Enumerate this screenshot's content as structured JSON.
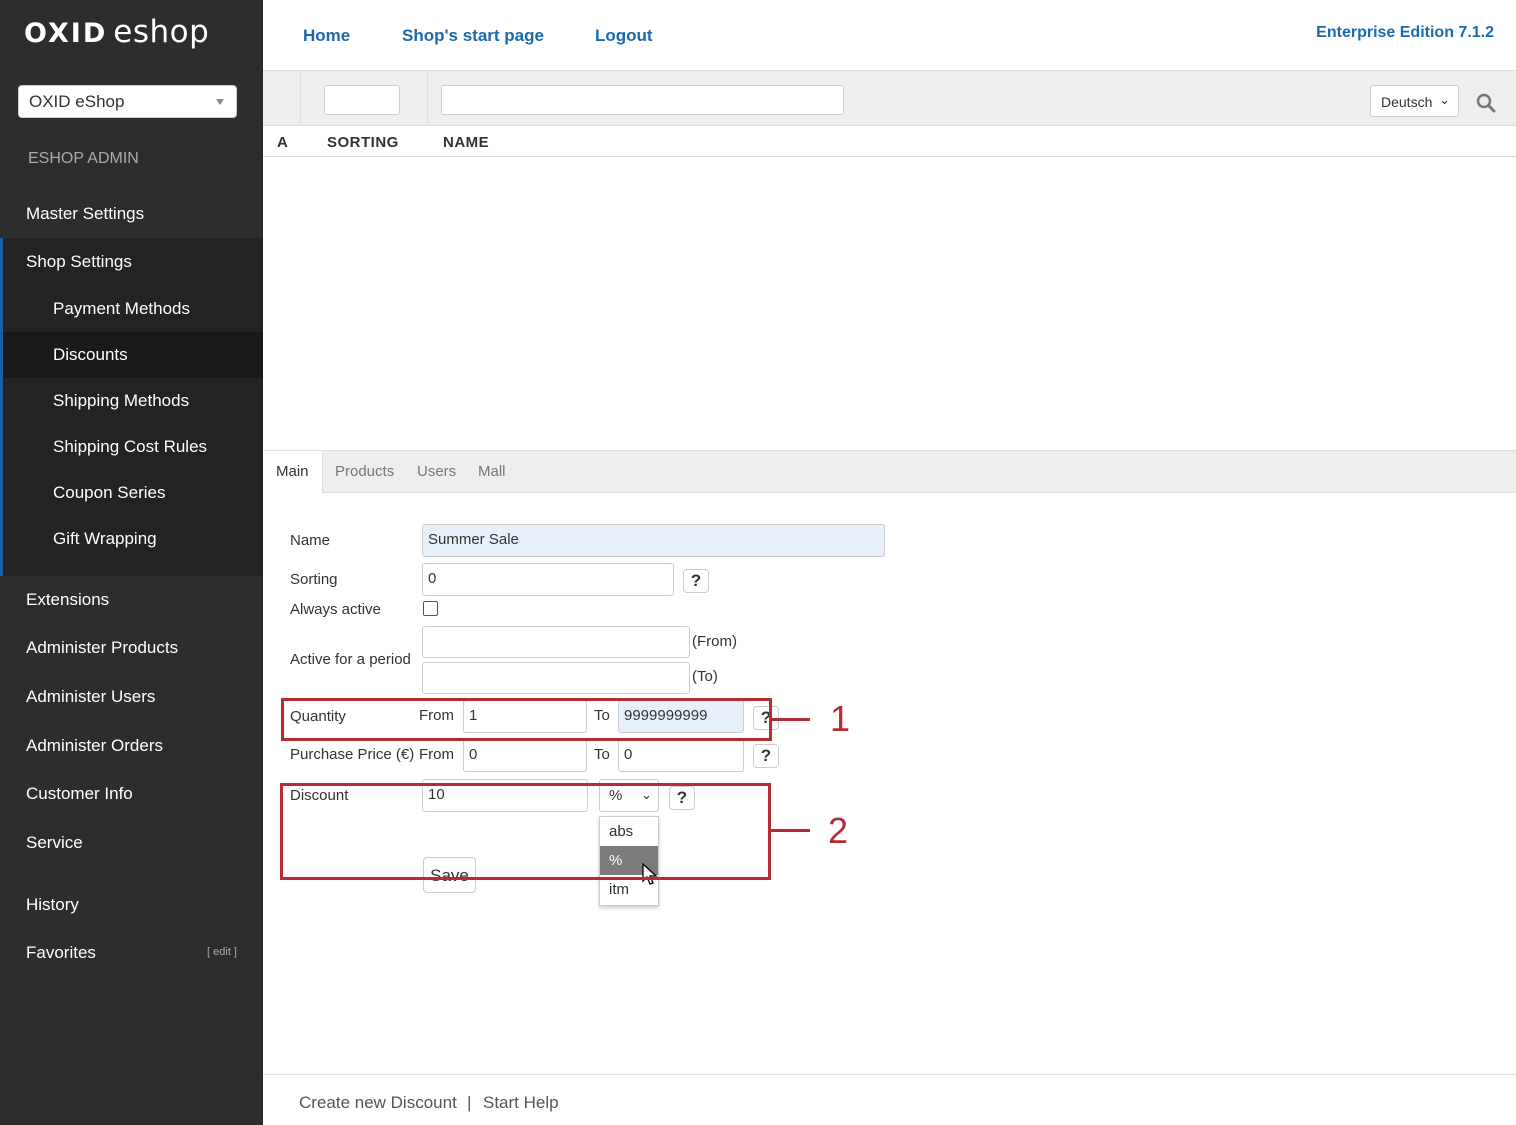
{
  "sidebar": {
    "logo_a": "OXID",
    "logo_b": "eshop",
    "shop_select": "OXID eShop",
    "section_label": "ESHOP ADMIN",
    "items": [
      {
        "label": "Master Settings"
      },
      {
        "label": "Shop Settings"
      },
      {
        "label": "Payment Methods"
      },
      {
        "label": "Discounts"
      },
      {
        "label": "Shipping Methods"
      },
      {
        "label": "Shipping Cost Rules"
      },
      {
        "label": "Coupon Series"
      },
      {
        "label": "Gift Wrapping"
      },
      {
        "label": "Extensions"
      },
      {
        "label": "Administer Products"
      },
      {
        "label": "Administer Users"
      },
      {
        "label": "Administer Orders"
      },
      {
        "label": "Customer Info"
      },
      {
        "label": "Service"
      },
      {
        "label": "History"
      },
      {
        "label": "Favorites"
      }
    ],
    "edit_label": "[ edit ]"
  },
  "topnav": {
    "home": "Home",
    "start_page": "Shop's start page",
    "logout": "Logout",
    "edition": "Enterprise Edition 7.1.2"
  },
  "list": {
    "language": "Deutsch",
    "col_a": "A",
    "col_sorting": "SORTING",
    "col_name": "NAME"
  },
  "tabs": [
    "Main",
    "Products",
    "Users",
    "Mall"
  ],
  "form": {
    "name_label": "Name",
    "name_value": "Summer Sale",
    "sorting_label": "Sorting",
    "sorting_value": "0",
    "always_active_label": "Always active",
    "period_label": "Active for a period",
    "from_suffix": "(From)",
    "to_suffix": "(To)",
    "quantity_label": "Quantity",
    "from_label": "From",
    "to_label": "To",
    "quantity_from": "1",
    "quantity_to": "9999999999",
    "price_label": "Purchase Price (€)",
    "price_from": "0",
    "price_to": "0",
    "discount_label": "Discount",
    "discount_value": "10",
    "unit_selected": "%",
    "unit_options": [
      "abs",
      "%",
      "itm"
    ],
    "save": "Save",
    "help": "?"
  },
  "annotations": [
    "1",
    "2"
  ],
  "footer": {
    "create": "Create new Discount",
    "separator": "|",
    "help": "Start Help"
  },
  "colors": {
    "sidebar": "#2d2d2d",
    "link": "#1a6ab0",
    "callout": "#b52c35"
  }
}
